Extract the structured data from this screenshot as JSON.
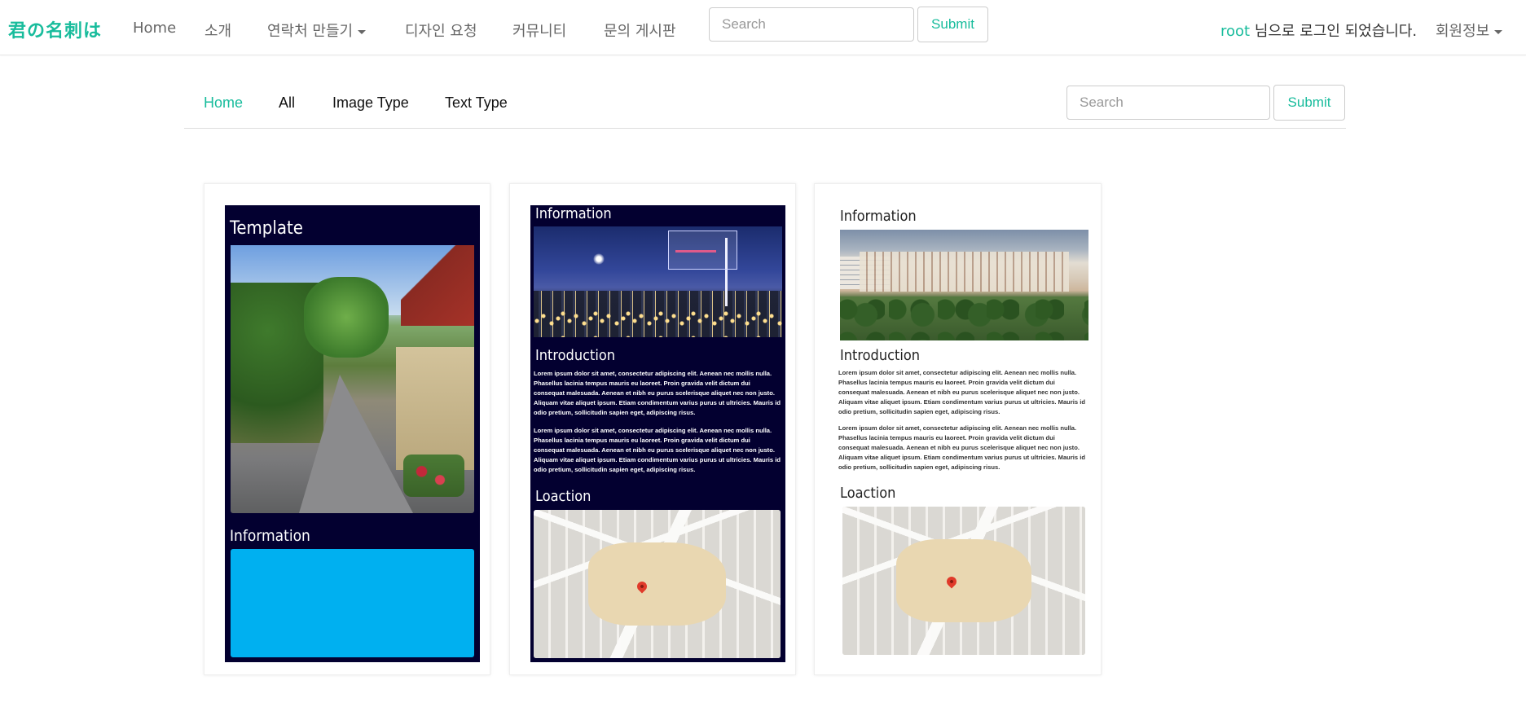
{
  "navbar": {
    "brand": "君の名刺は",
    "items": [
      "Home",
      "소개",
      "연락처 만들기",
      "디자인 요청",
      "커뮤니티",
      "문의 게시판"
    ],
    "search_placeholder": "Search",
    "submit_label": "Submit",
    "login_user": "root",
    "login_suffix": " 님으로 로그인 되었습니다.",
    "member_menu": "회원정보"
  },
  "subnav": {
    "tabs": [
      "Home",
      "All",
      "Image Type",
      "Text Type"
    ],
    "active_tab": "Home",
    "search_placeholder": "Search",
    "submit_label": "Submit"
  },
  "cards": [
    {
      "theme": "dark",
      "sections": {
        "title": "Template",
        "info": "Information"
      }
    },
    {
      "theme": "dark",
      "sections": {
        "info": "Information",
        "intro": "Introduction",
        "location": "Loaction"
      },
      "paragraph": "Lorem ipsum dolor sit amet, consectetur adipiscing elit. Aenean nec mollis nulla. Phasellus lacinia tempus mauris eu laoreet. Proin gravida velit dictum dui consequat malesuada. Aenean et nibh eu purus scelerisque aliquet nec non justo. Aliquam vitae aliquet ipsum. Etiam condimentum varius purus ut ultricies. Mauris id odio pretium, sollicitudin sapien eget, adipiscing risus."
    },
    {
      "theme": "light",
      "sections": {
        "info": "Information",
        "intro": "Introduction",
        "location": "Loaction"
      },
      "paragraph": "Lorem ipsum dolor sit amet, consectetur adipiscing elit. Aenean nec mollis nulla. Phasellus lacinia tempus mauris eu laoreet. Proin gravida velit dictum dui consequat malesuada. Aenean et nibh eu purus scelerisque aliquet nec non justo. Aliquam vitae aliquet ipsum. Etiam condimentum varius purus ut ultricies. Mauris id odio pretium, sollicitudin sapien eget, adipiscing risus."
    }
  ],
  "colors": {
    "accent": "#18bc9c",
    "card_dark_bg": "#030030",
    "info_box": "#00b0f0"
  }
}
